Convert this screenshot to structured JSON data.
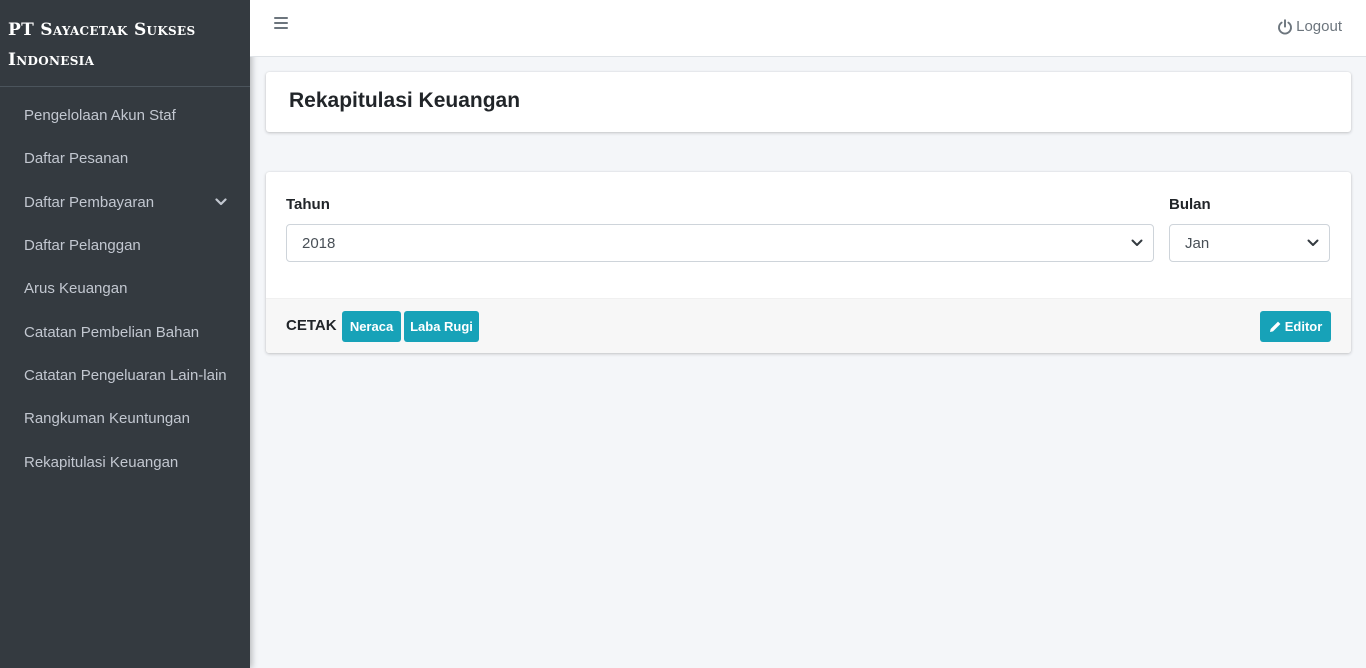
{
  "sidebar": {
    "brand": "PT Sayacetak Sukses Indonesia",
    "items": [
      {
        "label": "Pengelolaan Akun Staf"
      },
      {
        "label": "Daftar Pesanan"
      },
      {
        "label": "Daftar Pembayaran",
        "icon": "chevron-down-icon"
      },
      {
        "label": "Daftar Pelanggan"
      },
      {
        "label": "Arus Keuangan"
      },
      {
        "label": "Catatan Pembelian Bahan"
      },
      {
        "label": "Catatan Pengeluaran Lain-lain"
      },
      {
        "label": "Rangkuman Keuntungan"
      },
      {
        "label": "Rekapitulasi Keuangan"
      }
    ]
  },
  "topbar": {
    "menu_icon": "hamburger-icon",
    "logout_icon": "power-icon",
    "logout_label": "Logout"
  },
  "page": {
    "title": "Rekapitulasi Keuangan"
  },
  "form": {
    "year_label": "Tahun",
    "year_value": "2018",
    "month_label": "Bulan",
    "month_value": "Jan"
  },
  "footer": {
    "print_label": "CETAK",
    "neraca_label": "Neraca",
    "laba_rugi_label": "Laba Rugi",
    "editor_label": "Editor",
    "editor_icon": "pencil-icon"
  },
  "colors": {
    "sidebar_bg": "#343a40",
    "accent": "#17a2b8",
    "page_bg": "#f4f6f9"
  }
}
